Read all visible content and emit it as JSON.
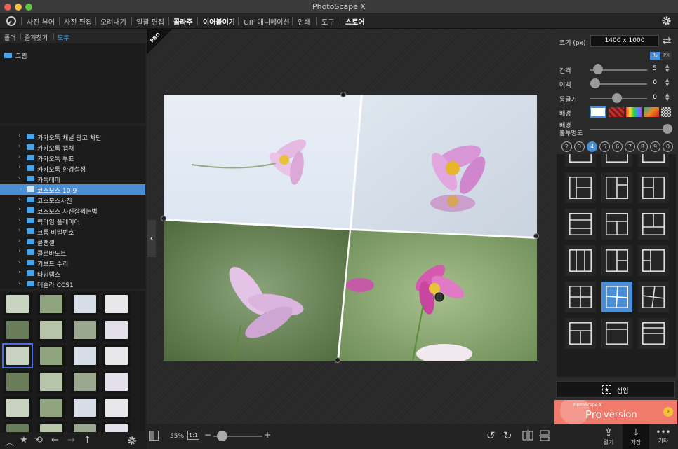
{
  "app": {
    "title": "PhotoScape X"
  },
  "nav": {
    "tabs": [
      "사진 뷰어",
      "사진 편집",
      "오려내기",
      "일괄 편집",
      "콜라주",
      "이어붙이기",
      "GIF 애니메이션",
      "인쇄",
      "도구",
      "스토어"
    ]
  },
  "left": {
    "folder_tabs": [
      "폴더",
      "즐겨찾기",
      "모두"
    ],
    "top_folder": "그림",
    "tree": [
      "카카오톡 채널 광고 차단",
      "카카오톡 캡쳐",
      "카카오톡 투표",
      "카카오톡 환경설정",
      "카톡테마",
      "코스모스 10-9",
      "코스모스사진",
      "코스모스 사진잘찍는법",
      "릭타임 플레이어",
      "크롬 비밀번호",
      "클램셸",
      "클로바노트",
      "키보드 수리",
      "타임랩스",
      "테슬라 CCS1"
    ],
    "selected_index": 5
  },
  "center": {
    "pro_badge": "PRO",
    "zoom": "55%",
    "one_to_one": "1:1",
    "minus": "−",
    "plus": "+"
  },
  "right": {
    "size_label": "크기 (px)",
    "size_value": "1400 x 1000",
    "unit_pct": "%",
    "unit_px": "PX",
    "spacing_label": "간격",
    "spacing_value": "5",
    "margin_label": "여백",
    "margin_value": "0",
    "round_label": "둥글기",
    "round_value": "0",
    "bg_label": "배경",
    "opacity_label1": "배경",
    "opacity_label2": "불투명도",
    "counts": [
      "2",
      "3",
      "4",
      "5",
      "6",
      "7",
      "8",
      "9",
      "0"
    ],
    "active_count": "4",
    "insert_label": "삽입",
    "ad_brand": "PhotoScape X",
    "ad_text1": "Pro",
    "ad_text2": "version"
  },
  "bottom_right": {
    "open": "열기",
    "save": "저장",
    "more": "기타"
  },
  "colors": {
    "accent": "#4a8fd6",
    "panel": "#222222"
  }
}
